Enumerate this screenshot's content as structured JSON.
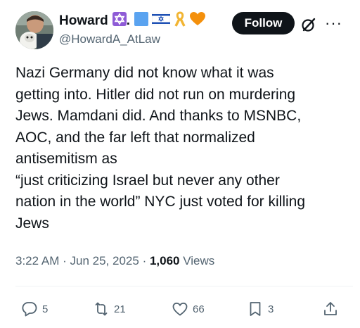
{
  "author": {
    "name": "Howard",
    "name_suffix": ".",
    "handle": "@HowardA_AtLaw",
    "badges": [
      "star-of-david-icon",
      "blue-square-icon",
      "israel-flag-icon",
      "yellow-ribbon-icon",
      "orange-heart-icon"
    ]
  },
  "header": {
    "follow_label": "Follow",
    "more_label": "···"
  },
  "tweet": {
    "lines": [
      "Nazi Germany did not know what it was",
      "getting into. Hitler did not run on murdering",
      "Jews. Mamdani did.  And thanks to MSNBC,",
      "AOC, and the far left that normalized",
      "antisemitism as",
      "“just criticizing Israel but never any other",
      "nation in the world” NYC just voted for killing",
      "Jews"
    ]
  },
  "meta": {
    "time": "3:22 AM",
    "separator": "·",
    "date": "Jun 25, 2025",
    "views_count": "1,060",
    "views_label": "Views"
  },
  "actions": {
    "replies": "5",
    "reposts": "21",
    "likes": "66",
    "bookmarks": "3"
  },
  "colors": {
    "text": "#0f1419",
    "secondary": "#536471",
    "button_bg": "#0f1419"
  }
}
